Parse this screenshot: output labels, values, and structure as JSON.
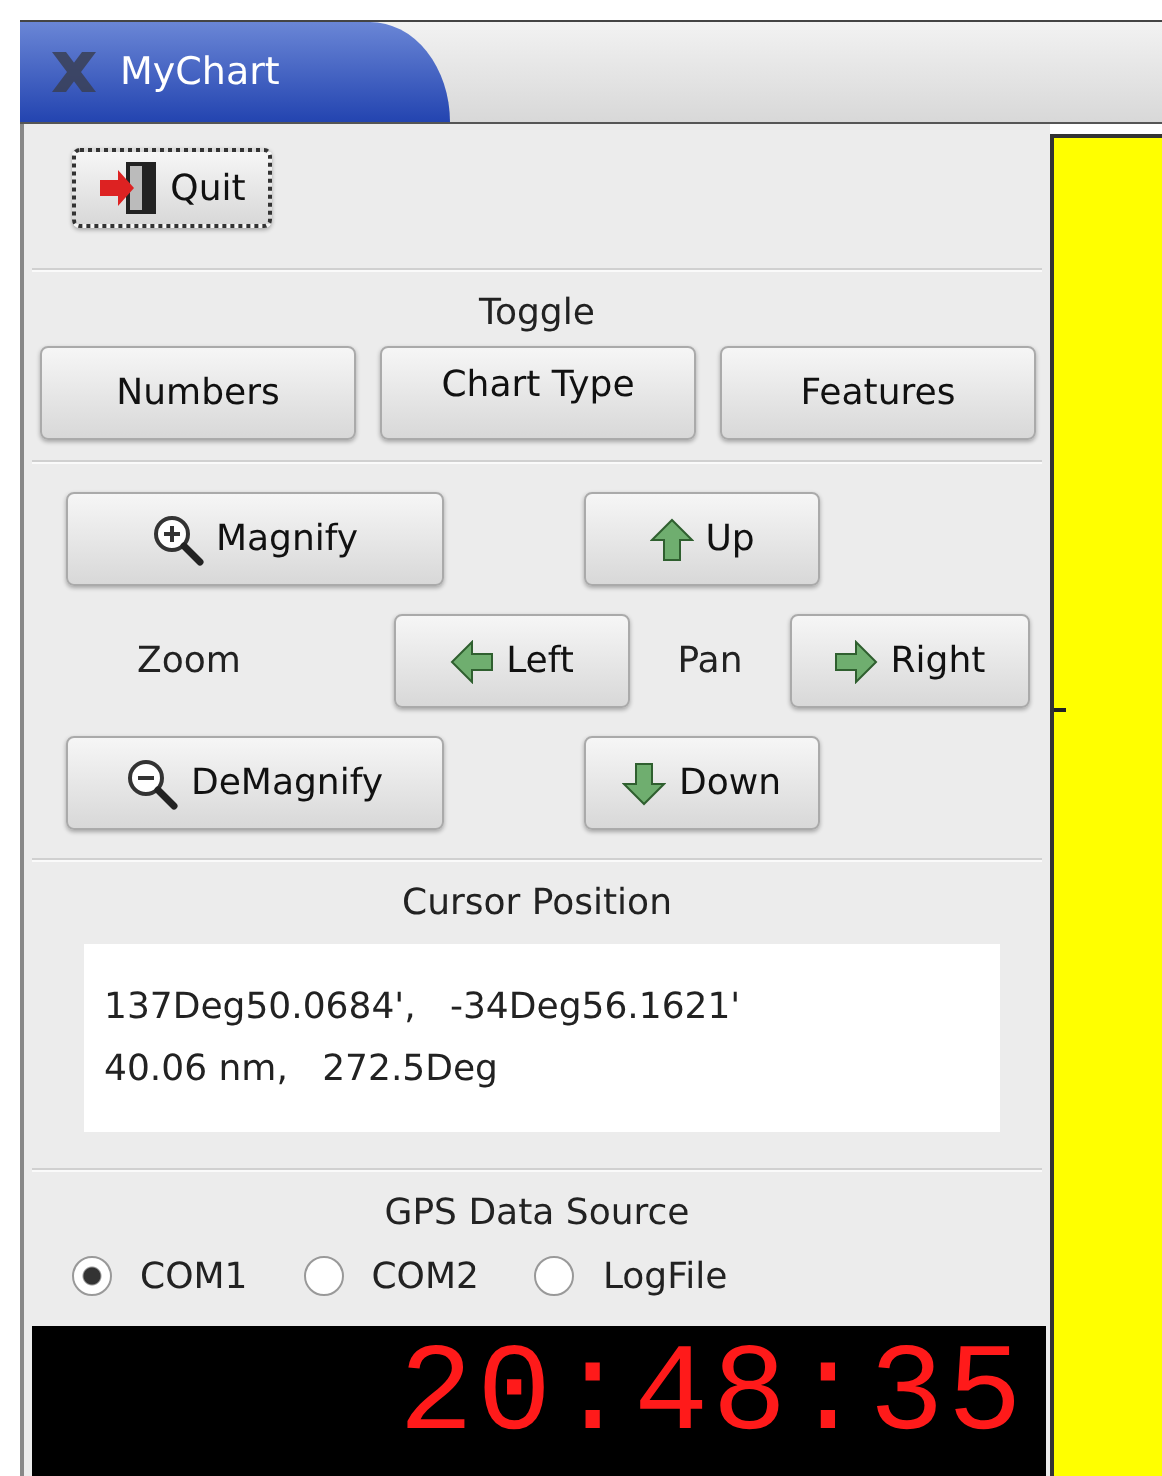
{
  "window": {
    "title": "MyChart"
  },
  "quit_button": {
    "label": "Quit"
  },
  "toggle": {
    "label": "Toggle",
    "buttons": [
      {
        "label": "Numbers"
      },
      {
        "label": "Chart Type"
      },
      {
        "label": "Features"
      }
    ]
  },
  "navigation": {
    "zoom_label": "Zoom",
    "pan_label": "Pan",
    "buttons": [
      {
        "label": "Magnify",
        "kind": "magnify"
      },
      {
        "label": "Up",
        "kind": "up"
      },
      {
        "label": "Left",
        "kind": "left"
      },
      {
        "label": "Right",
        "kind": "right"
      },
      {
        "label": "DeMagnify",
        "kind": "demagnify"
      },
      {
        "label": "Down",
        "kind": "down"
      }
    ]
  },
  "cursor_position": {
    "label": "Cursor Position",
    "lines": [
      "137Deg50.0684',   -34Deg56.1621'",
      "40.06 nm,   272.5Deg"
    ]
  },
  "gps_source": {
    "label": "GPS Data Source",
    "options": [
      {
        "label": "COM1",
        "selected": true
      },
      {
        "label": "COM2",
        "selected": false
      },
      {
        "label": "LogFile",
        "selected": false
      }
    ]
  },
  "clock": {
    "time": "20:48:35"
  }
}
